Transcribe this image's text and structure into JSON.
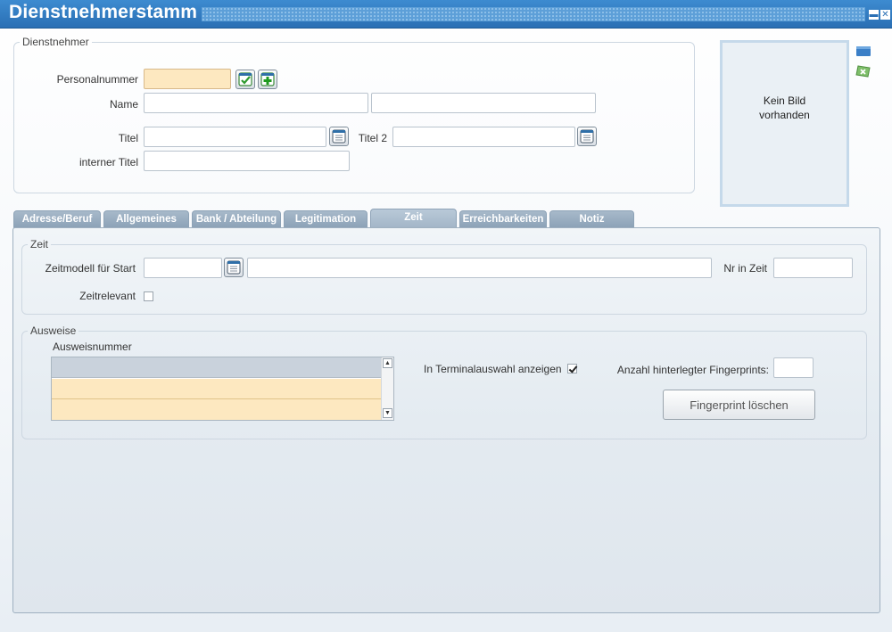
{
  "window": {
    "title": "Dienstnehmerstamm",
    "minimize_glyph": "▬",
    "close_glyph": "✕"
  },
  "employee": {
    "legend": "Dienstnehmer",
    "personalnummer_label": "Personalnummer",
    "personalnummer_value": "",
    "name_label": "Name",
    "name_first_value": "",
    "name_last_value": "",
    "titel_label": "Titel",
    "titel_value": "",
    "titel2_label": "Titel 2",
    "titel2_value": "",
    "interner_titel_label": "interner Titel",
    "interner_titel_value": ""
  },
  "photo": {
    "line1": "Kein Bild",
    "line2": "vorhanden"
  },
  "tabs": [
    {
      "label": "Adresse/Beruf",
      "active": false
    },
    {
      "label": "Allgemeines",
      "active": false
    },
    {
      "label": "Bank / Abteilung",
      "active": false
    },
    {
      "label": "Legitimation",
      "active": false
    },
    {
      "label": "Zeit",
      "active": true
    },
    {
      "label": "Erreichbarkeiten",
      "active": false
    },
    {
      "label": "Notiz",
      "active": false
    }
  ],
  "zeit": {
    "legend": "Zeit",
    "zeitmodell_label": "Zeitmodell für Start",
    "zeitmodell_value": "",
    "zeitmodell_desc_value": "",
    "nr_in_zeit_label": "Nr in Zeit",
    "nr_in_zeit_value": "",
    "zeitrelevant_label": "Zeitrelevant",
    "zeitrelevant_checked": false
  },
  "ausweise": {
    "legend": "Ausweise",
    "column_header": "Ausweisnummer",
    "rows": [
      "",
      "",
      ""
    ],
    "terminal_label": "In Terminalauswahl anzeigen",
    "terminal_checked": true,
    "fingerprints_label": "Anzahl hinterlegter Fingerprints:",
    "fingerprints_value": "",
    "delete_fingerprint_label": "Fingerprint löschen"
  },
  "colors": {
    "titlebar": "#2a6fb4",
    "required_field": "#fde8c0",
    "tab": "#8ba1b6",
    "grid_selected_row": "#c9d2dc"
  }
}
